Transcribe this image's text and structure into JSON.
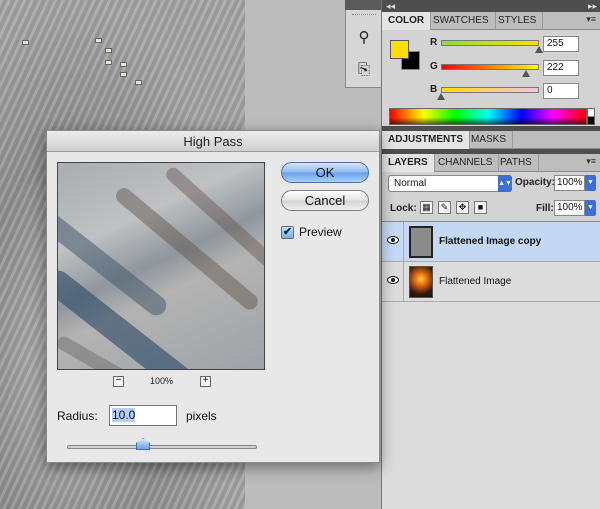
{
  "color_panel": {
    "tabs": [
      "COLOR",
      "SWATCHES",
      "STYLES"
    ],
    "foreground_color": "#ffde00",
    "background_color": "#000000",
    "channels": [
      {
        "label": "R",
        "value": "255",
        "slider_fraction": 1.0,
        "gradient": [
          "#88dd44",
          "#ffde00"
        ]
      },
      {
        "label": "G",
        "value": "222",
        "slider_fraction": 0.87,
        "gradient": [
          "#ff0000",
          "#ffff00"
        ]
      },
      {
        "label": "B",
        "value": "0",
        "slider_fraction": 0.0,
        "gradient": [
          "#ffde00",
          "#f2c4e8"
        ]
      }
    ]
  },
  "adjustments_panel": {
    "tabs": [
      "ADJUSTMENTS",
      "MASKS"
    ]
  },
  "layers_panel": {
    "tabs": [
      "LAYERS",
      "CHANNELS",
      "PATHS"
    ],
    "blend_mode": "Normal",
    "opacity_label": "Opacity:",
    "opacity_value": "100%",
    "lock_label": "Lock:",
    "fill_label": "Fill:",
    "fill_value": "100%",
    "layers": [
      {
        "name": "Flattened Image copy",
        "selected": true
      },
      {
        "name": "Flattened Image",
        "selected": false
      }
    ]
  },
  "high_pass_dialog": {
    "title": "High Pass",
    "ok_label": "OK",
    "cancel_label": "Cancel",
    "preview_label": "Preview",
    "preview_checked": true,
    "zoom_minus": "−",
    "zoom_plus": "+",
    "zoom_level": "100%",
    "radius_label": "Radius:",
    "radius_value": "10.0",
    "radius_unit": "pixels",
    "radius_slider_fraction": 0.4
  },
  "icons": {
    "tool_1": "type-mask-tool-icon",
    "tool_2": "stamp-tool-icon",
    "lock_transparent": "lock-transparent-icon",
    "lock_paint": "brush-lock-icon",
    "lock_move": "move-lock-icon",
    "lock_all": "padlock-icon",
    "visibility": "eye-icon"
  }
}
